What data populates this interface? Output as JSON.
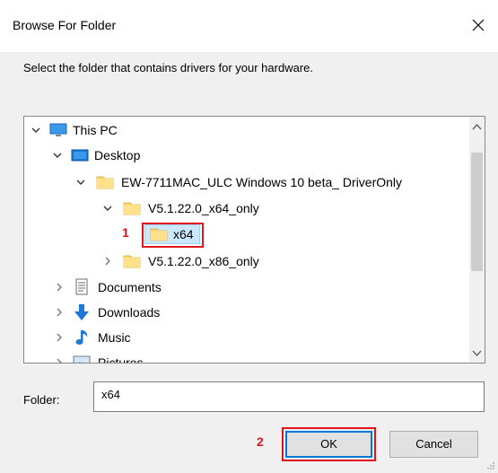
{
  "dialog": {
    "title": "Browse For Folder",
    "instruction": "Select the folder that contains drivers for your hardware."
  },
  "tree": {
    "items": [
      {
        "label": "This PC",
        "expanded": true,
        "icon": "monitor-icon"
      },
      {
        "label": "Desktop",
        "expanded": true,
        "icon": "desktop-icon"
      },
      {
        "label": "EW-7711MAC_ULC Windows 10 beta_ DriverOnly",
        "expanded": true,
        "icon": "folder-icon"
      },
      {
        "label": "V5.1.22.0_x64_only",
        "expanded": true,
        "icon": "folder-icon"
      },
      {
        "label": "x64",
        "selected": true,
        "icon": "folder-icon"
      },
      {
        "label": "V5.1.22.0_x86_only",
        "expanded": false,
        "icon": "folder-icon"
      },
      {
        "label": "Documents",
        "expanded": false,
        "icon": "documents-icon"
      },
      {
        "label": "Downloads",
        "expanded": false,
        "icon": "download-arrow-icon"
      },
      {
        "label": "Music",
        "expanded": false,
        "icon": "music-note-icon"
      },
      {
        "label": "Pictures",
        "expanded": false,
        "icon": "pictures-icon"
      }
    ]
  },
  "folder_field": {
    "label": "Folder:",
    "value": "x64"
  },
  "buttons": {
    "ok": "OK",
    "cancel": "Cancel"
  },
  "annotations": {
    "step1": "1",
    "step2": "2",
    "highlight_color": "#e0151b"
  },
  "colors": {
    "folder": "#ffd66b",
    "selection": "#cce8ff",
    "accent": "#0078d7"
  }
}
